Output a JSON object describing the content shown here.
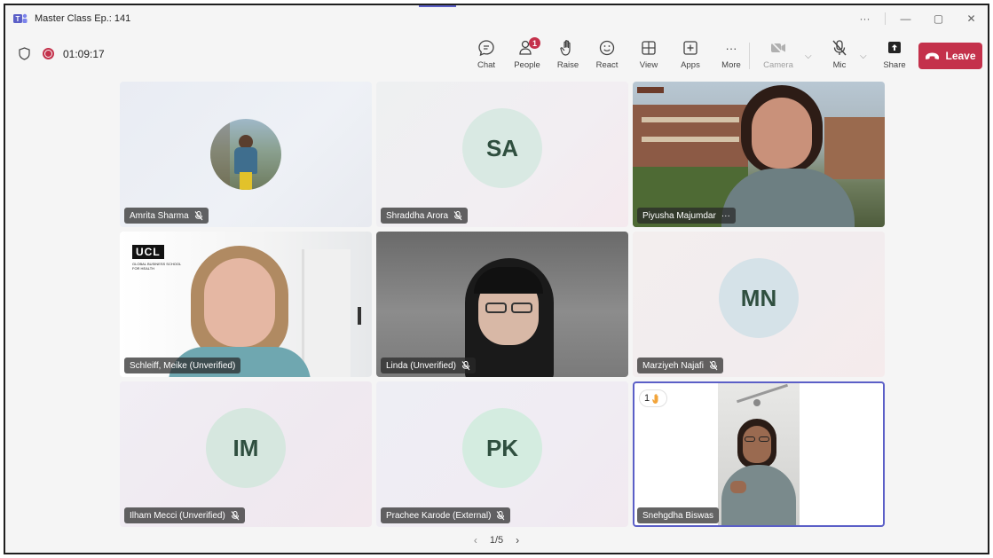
{
  "window": {
    "title": "Master Class Ep.: 141",
    "more": "···",
    "minimize": "—",
    "restore": "▢",
    "close": "✕"
  },
  "toolbar": {
    "timer": "01:09:17",
    "chat": "Chat",
    "people": "People",
    "people_badge": "1",
    "raise": "Raise",
    "react": "React",
    "view": "View",
    "apps": "Apps",
    "more": "More",
    "more_dots": "···",
    "camera": "Camera",
    "mic": "Mic",
    "share": "Share",
    "leave": "Leave",
    "chevron": "⌵"
  },
  "colors": {
    "accent": "#5b5fc7",
    "leave": "#c4314b"
  },
  "participants": [
    {
      "name": "Amrita Sharma",
      "muted": true,
      "type": "photo"
    },
    {
      "name": "Shraddha Arora",
      "muted": true,
      "type": "initials",
      "initials": "SA"
    },
    {
      "name": "Piyusha Majumdar",
      "muted": false,
      "more": "···",
      "type": "video"
    },
    {
      "name": "Schleiff, Meike (Unverified)",
      "muted": false,
      "type": "video",
      "logo": "UCL",
      "logo_sub": "GLOBAL BUSINESS SCHOOL FOR HEALTH"
    },
    {
      "name": "Linda (Unverified)",
      "muted": true,
      "type": "video"
    },
    {
      "name": "Marziyeh Najafi",
      "muted": true,
      "type": "initials",
      "initials": "MN"
    },
    {
      "name": "Ilham Mecci (Unverified)",
      "muted": true,
      "type": "initials",
      "initials": "IM"
    },
    {
      "name": "Prachee Karode (External)",
      "muted": true,
      "type": "initials",
      "initials": "PK"
    },
    {
      "name": "Snehgdha Biswas",
      "muted": false,
      "type": "video",
      "raised_hand_order": "1",
      "active": true
    }
  ],
  "pager": {
    "label": "1/5",
    "prev": "‹",
    "next": "›"
  }
}
